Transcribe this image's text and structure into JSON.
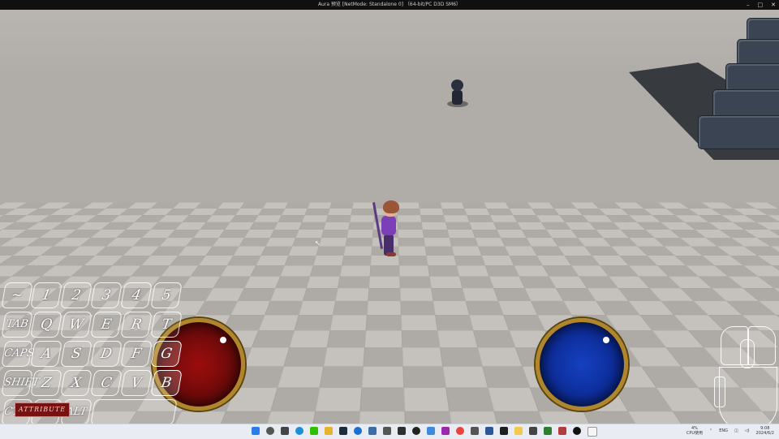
{
  "window": {
    "title": "Aura 预览 [NetMode: Standalone 0]  （64-bit/PC D3D SM6）",
    "controls": [
      "–",
      "□",
      "✕"
    ]
  },
  "hud": {
    "health_globe": {
      "color": "#8b0c0c",
      "icon": "health-globe"
    },
    "mana_globe": {
      "color": "#0f35b0",
      "icon": "mana-globe"
    },
    "attribute_button": "ATTRIBUTE",
    "keyboard_rows": [
      [
        "~",
        "1",
        "2",
        "3",
        "4",
        "5"
      ],
      [
        "TAB",
        "Q",
        "W",
        "E",
        "R",
        "T"
      ],
      [
        "CAPS",
        "A",
        "S",
        "D",
        "F",
        "G"
      ],
      [
        "SHIFT",
        "Z",
        "X",
        "C",
        "V",
        "B"
      ],
      [
        "CTRL",
        "",
        "ALT",
        ""
      ]
    ],
    "highlighted_keys": [
      "G",
      "B"
    ]
  },
  "taskbar": {
    "icons": [
      "windows-start-icon",
      "search-icon",
      "task-view-icon",
      "edge-icon",
      "wechat-icon",
      "file-explorer-icon",
      "app-icon",
      "app-icon",
      "app-icon",
      "app-icon",
      "app-icon",
      "rider-icon",
      "vscode-icon",
      "app-icon",
      "chrome-icon",
      "app-icon",
      "app-icon",
      "terminal-icon",
      "folder-icon",
      "app-icon",
      "app-icon",
      "app-icon",
      "unreal-icon",
      "typora-icon"
    ],
    "cpu_value": "4%",
    "cpu_label": "CPU使用",
    "language": "ENG",
    "time": "9:08",
    "date": "2024/6/2"
  }
}
